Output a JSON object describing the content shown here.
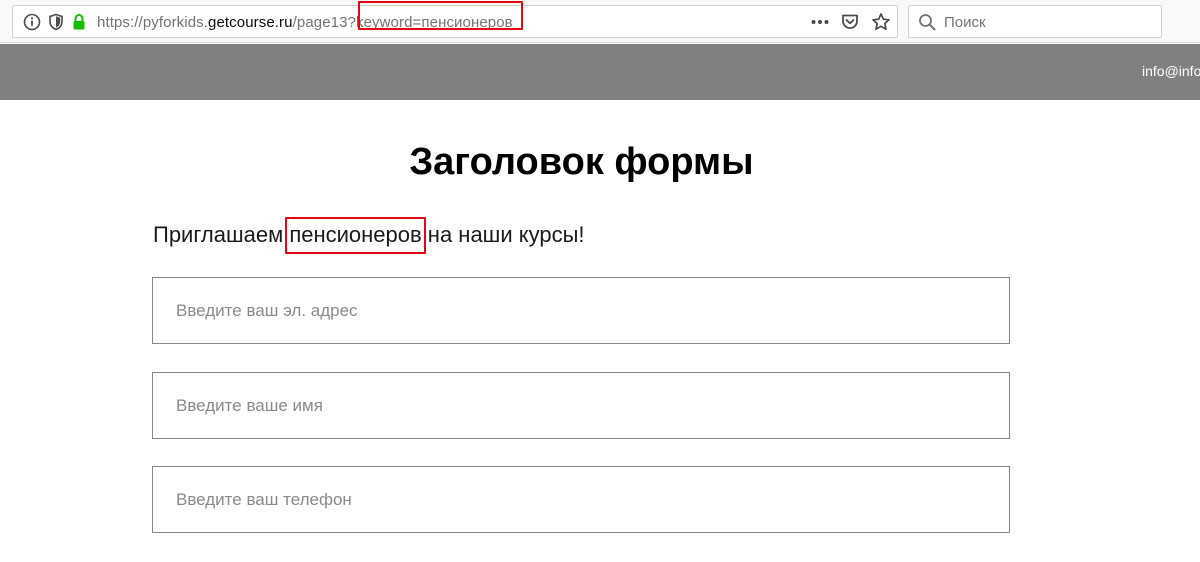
{
  "browser": {
    "url": {
      "prefix": "https://pyforkids.",
      "domain": "getcourse.ru",
      "path": "/page13?",
      "query": "keyword=пенсионеров"
    },
    "search": {
      "placeholder": "Поиск"
    },
    "icons": [
      "info-icon",
      "shield-icon",
      "lock-icon",
      "more-icon",
      "pocket-icon",
      "star-icon",
      "search-icon"
    ],
    "highlight_color": "#e30613"
  },
  "header": {
    "contact": "info@info",
    "background": "#808080"
  },
  "form": {
    "title": "Заголовок формы",
    "lead_before": "Приглашаем ",
    "lead_keyword": "пенсионеров",
    "lead_after": " на наши курсы!",
    "fields": {
      "email_placeholder": "Введите ваш эл. адрес",
      "name_placeholder": "Введите ваше имя",
      "phone_placeholder": "Введите ваш телефон"
    }
  }
}
